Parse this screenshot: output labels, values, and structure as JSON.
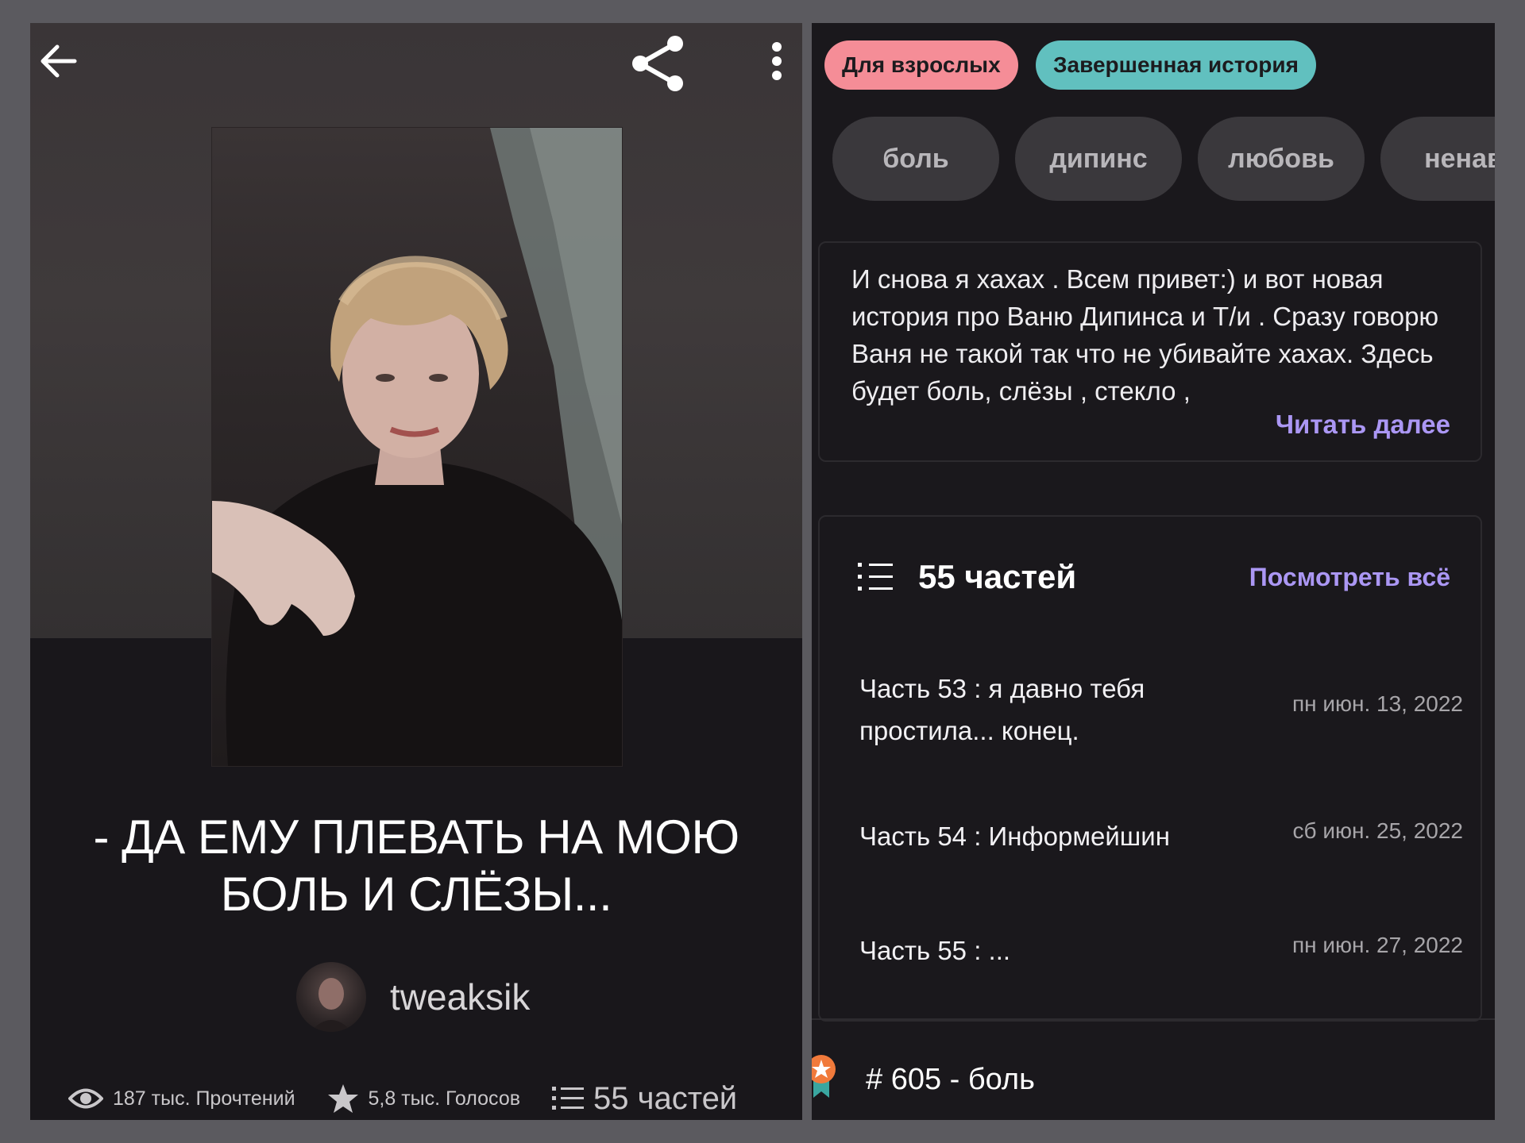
{
  "left": {
    "title": "- ДА ЕМУ ПЛЕВАТЬ НА МОЮ БОЛЬ И СЛЁЗЫ...",
    "author": "tweaksik",
    "stats": {
      "reads": "187 тыс. Прочтений",
      "votes": "5,8 тыс. Голосов",
      "parts": "55 частей"
    },
    "icons": {
      "back": "arrow-left-icon",
      "share": "share-icon",
      "more": "more-vertical-icon",
      "reads": "eye-icon",
      "votes": "star-icon",
      "parts": "list-icon"
    }
  },
  "right": {
    "badges": [
      "Для взрослых",
      "Завершенная история"
    ],
    "tags": [
      "боль",
      "дипинс",
      "любовь",
      "ненав"
    ],
    "description": "И снова я хахах . Всем привет:) и вот новая история про Ваню Дипинса и Т/и . Сразу говорю Ваня не такой так что не убивайте хахах. Здесь будет боль, слёзы , стекло ,",
    "read_more": "Читать далее",
    "parts_count": "55 частей",
    "view_all": "Посмотреть всё",
    "parts": [
      {
        "title": "Часть 53 : я давно тебя простила... конец.",
        "date": "пн июн. 13, 2022"
      },
      {
        "title": "Часть 54 : Информейшин",
        "date": "сб июн. 25, 2022"
      },
      {
        "title": "Часть 55 : ...",
        "date": "пн июн. 27, 2022"
      }
    ],
    "rank": "# 605 - боль"
  },
  "colors": {
    "badge_mature": "#f58d97",
    "badge_complete": "#61c0bf",
    "link": "#ab97f4"
  }
}
